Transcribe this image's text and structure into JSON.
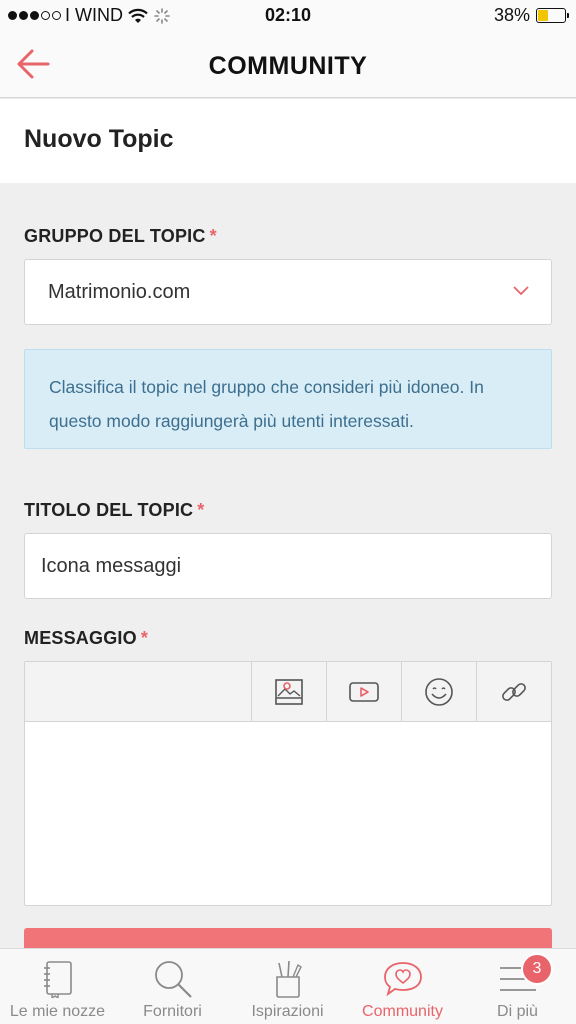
{
  "status_bar": {
    "carrier": "I WIND",
    "time": "02:10",
    "battery": "38%"
  },
  "header": {
    "title": "COMMUNITY",
    "back_icon": "arrow-left-icon"
  },
  "page": {
    "title": "Nuovo Topic"
  },
  "form": {
    "group_label": "GRUPPO DEL TOPIC",
    "required_mark": "*",
    "group_value": "Matrimonio.com",
    "info_text": "Classifica il topic nel gruppo che consideri più idoneo. In questo modo raggiungerà più utenti interessati.",
    "title_label": "TITOLO DEL TOPIC",
    "title_value": "Icona messaggi",
    "message_label": "MESSAGGIO",
    "message_value": "",
    "toolbar": [
      "image-icon",
      "video-icon",
      "emoji-icon",
      "link-icon"
    ]
  },
  "tabbar": {
    "items": [
      {
        "label": "Le mie nozze",
        "icon": "notebook-icon"
      },
      {
        "label": "Fornitori",
        "icon": "search-icon"
      },
      {
        "label": "Ispirazioni",
        "icon": "pencil-cup-icon"
      },
      {
        "label": "Community",
        "icon": "heart-chat-icon",
        "active": true
      },
      {
        "label": "Di più",
        "icon": "menu-icon",
        "badge": "3"
      }
    ]
  },
  "colors": {
    "accent": "#e8646a",
    "info_bg": "#d9edf7",
    "info_text": "#3d6f8f"
  }
}
